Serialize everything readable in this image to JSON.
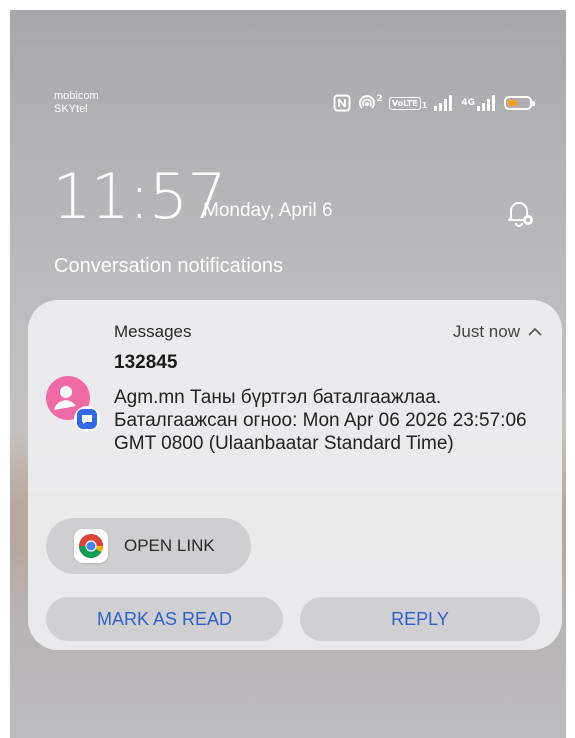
{
  "status_bar": {
    "carrier_1": "mobicom",
    "carrier_2": "SKYtel",
    "nfc_icon": "nfc-icon",
    "hotspot_sup": "2",
    "volte": "VoLTE",
    "volte_sub": "1",
    "network": "4G",
    "battery_color": "#ff9d1e"
  },
  "lockscreen": {
    "time": "11:57",
    "date": "Monday, April 6",
    "section_title": "Conversation notifications"
  },
  "notification": {
    "app_name": "Messages",
    "timestamp": "Just now",
    "sender": "132845",
    "body": "Agm.mn Таны бүртгэл баталгаажлаа. Баталгаажсан огноо: Mon Apr 06 2026 23:57:06 GMT 0800 (Ulaanbaatar Standard Time)",
    "avatar_color": "#f06aa6",
    "open_link_label": "OPEN LINK",
    "actions": [
      {
        "label": "MARK AS READ"
      },
      {
        "label": "REPLY"
      }
    ],
    "action_color": "#2f5fd1"
  }
}
